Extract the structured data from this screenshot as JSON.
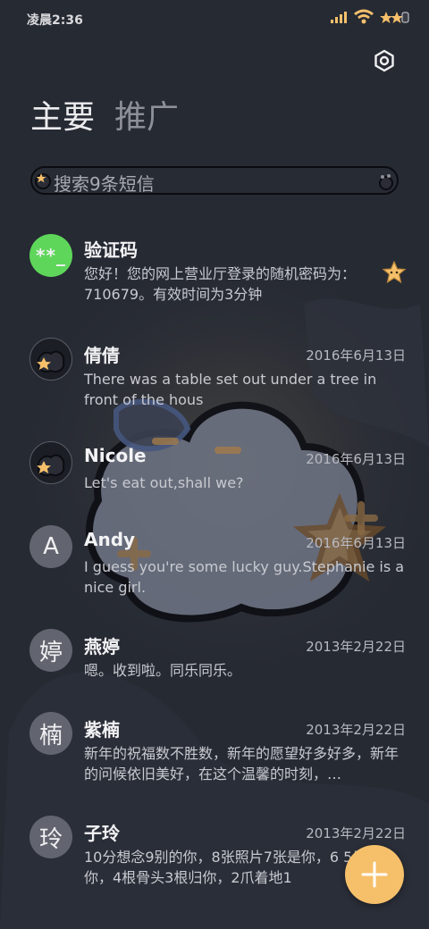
{
  "status_bar": {
    "time": "凌晨2:36"
  },
  "tabs": [
    {
      "label": "主要"
    },
    {
      "label": "推广"
    }
  ],
  "search": {
    "placeholder": "搜索9条短信"
  },
  "messages": [
    {
      "sender": "验证码",
      "avatar": "**_",
      "date": "",
      "preview": "您好！您的网上营业厅登录的随机密码为：710679。有效时间为3分钟"
    },
    {
      "sender": "倩倩",
      "avatar": "",
      "date": "2016年6月13日",
      "preview": "There was a table set out under a tree in front of the hous"
    },
    {
      "sender": "Nicole",
      "avatar": "",
      "date": "2016年6月13日",
      "preview": "Let's eat out,shall we?"
    },
    {
      "sender": "Andy",
      "avatar": "A",
      "date": "2016年6月13日",
      "preview": "I guess you're some lucky guy.Stephanie is a nice girl."
    },
    {
      "sender": "燕婷",
      "avatar": "婷",
      "date": "2013年2月22日",
      "preview": "嗯。收到啦。同乐同乐。"
    },
    {
      "sender": "紫楠",
      "avatar": "楠",
      "date": "2013年2月22日",
      "preview": "新年的祝福数不胜数，新年的愿望好多好多，新年的问候依旧美好，在这个温馨的时刻，…"
    },
    {
      "sender": "子玲",
      "avatar": "玲",
      "date": "2013年2月22日",
      "preview": "10分想念9别的你，8张照片7张是你，6 5只像你，4根骨头3根归你，2爪着地1"
    }
  ],
  "colors": {
    "accent": "#f6c06b",
    "background": "#262a33",
    "verification_avatar": "#5ed65a"
  },
  "icons": {
    "settings": "settings-icon",
    "compose": "plus-icon",
    "search": "search-icon"
  }
}
